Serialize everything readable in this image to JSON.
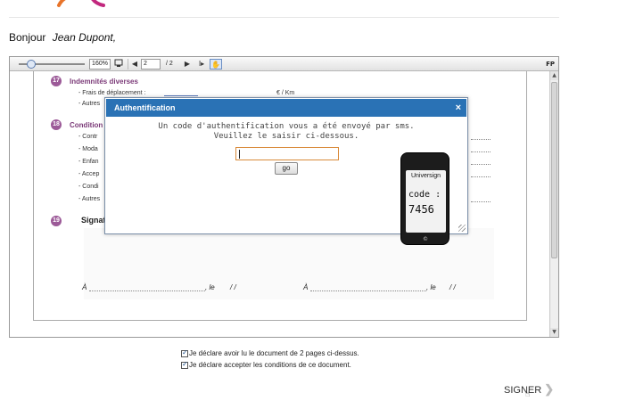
{
  "greeting": {
    "hello": "Bonjour",
    "name": "Jean Dupont,"
  },
  "viewer": {
    "toolbar": {
      "zoom": "160%",
      "page_current": "2",
      "page_total": "/ 2",
      "fp_label": "FP"
    },
    "document": {
      "sections": [
        {
          "number": "17",
          "title": "Indemnités diverses"
        },
        {
          "number": "18",
          "title": "Condition"
        },
        {
          "number": "19",
          "title": "Signat"
        }
      ],
      "lines_17": [
        "- Frais de déplacement :",
        "- Autres"
      ],
      "per_km": "€ / Km",
      "lines_18": [
        "- Contr",
        "- Moda",
        "- Enfan",
        "- Accep",
        "- Condi",
        "- Autres"
      ],
      "sig_left_a": "À",
      "sig_left_le": ", le",
      "sig_left_date": "/     /",
      "sig_right_a": "À",
      "sig_right_le": ", le",
      "sig_right_date": "/     /"
    }
  },
  "modal": {
    "title": "Authentification",
    "close": "×",
    "message_line1": "Un code d'authentification vous a été envoyé par sms.",
    "message_line2": "Veuillez le saisir ci-dessous.",
    "input_value": "",
    "go_label": "go"
  },
  "phone": {
    "brand": "Universign",
    "code_label": "code :",
    "code_value": "7456",
    "home_icon": "©"
  },
  "checkboxes": [
    {
      "label": "Je déclare avoir lu le document de 2 pages ci-dessus.",
      "checked": true
    },
    {
      "label": "Je déclare accepter les conditions de ce document.",
      "checked": true
    }
  ],
  "sign_button": {
    "label": "SIGNER",
    "arrow": "❯"
  },
  "colors": {
    "accent": "#2a72b5",
    "section": "#9c5a98",
    "logo_orange": "#e8742a",
    "logo_magenta": "#c2287e"
  }
}
